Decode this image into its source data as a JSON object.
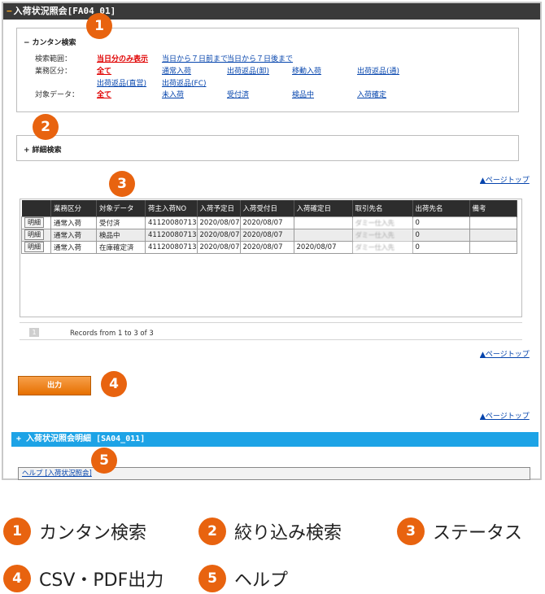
{
  "screen": {
    "title": "入荷状況照会[FA04_01]",
    "simple_search": {
      "header": "カンタン検索",
      "rows": [
        {
          "label": "検索範囲：",
          "options": [
            "当日分のみ表示",
            "当日から７日前まで",
            "当日から７日後まで"
          ]
        },
        {
          "label": "業務区分：",
          "options": [
            "全て",
            "通常入荷",
            "出荷返品(卸)",
            "移動入荷",
            "出荷返品(通)"
          ]
        },
        {
          "label": "",
          "options": [
            "出荷返品(直営)",
            "出荷返品(FC)"
          ]
        },
        {
          "label": "対象データ：",
          "options": [
            "全て",
            "未入荷",
            "受付済",
            "検品中",
            "入荷確定"
          ]
        }
      ]
    },
    "detail_search": {
      "header": "詳細検索"
    },
    "pagetop_label": "▲ページトップ",
    "grid": {
      "columns": [
        "",
        "業務区分",
        "対象データ",
        "荷主入荷NO",
        "入荷予定日",
        "入荷受付日",
        "入荷確定日",
        "取引先名",
        "出荷先名",
        "備考"
      ],
      "rows": [
        [
          "明細",
          "通常入荷",
          "受付済",
          "41120080713",
          "2020/08/07",
          "2020/08/07",
          "",
          "ダミー仕入先",
          "0",
          ""
        ],
        [
          "明細",
          "通常入荷",
          "検品中",
          "41120080713",
          "2020/08/07",
          "2020/08/07",
          "",
          "ダミー仕入先",
          "0",
          ""
        ],
        [
          "明細",
          "通常入荷",
          "在庫確定済",
          "41120080713",
          "2020/08/07",
          "2020/08/07",
          "2020/08/07",
          "ダミー仕入先",
          "0",
          ""
        ]
      ]
    },
    "pager": {
      "page": "1",
      "records_text": "Records from 1 to 3 of 3"
    },
    "output_button": "出力",
    "detail_bar": "入荷状況照会明細 [SA04_011]",
    "help_link": "ヘルプ [入荷状況照会]"
  },
  "callouts": [
    "1",
    "2",
    "3",
    "4",
    "5"
  ],
  "legend": [
    {
      "num": "1",
      "label": "カンタン検索"
    },
    {
      "num": "2",
      "label": "絞り込み検索"
    },
    {
      "num": "3",
      "label": "ステータス"
    },
    {
      "num": "4",
      "label": "CSV・PDF出力"
    },
    {
      "num": "5",
      "label": "ヘルプ"
    }
  ],
  "colors": {
    "accent": "#e8630f",
    "link": "#0645ad",
    "active": "#e00000",
    "detail_bar": "#1da3e6"
  }
}
